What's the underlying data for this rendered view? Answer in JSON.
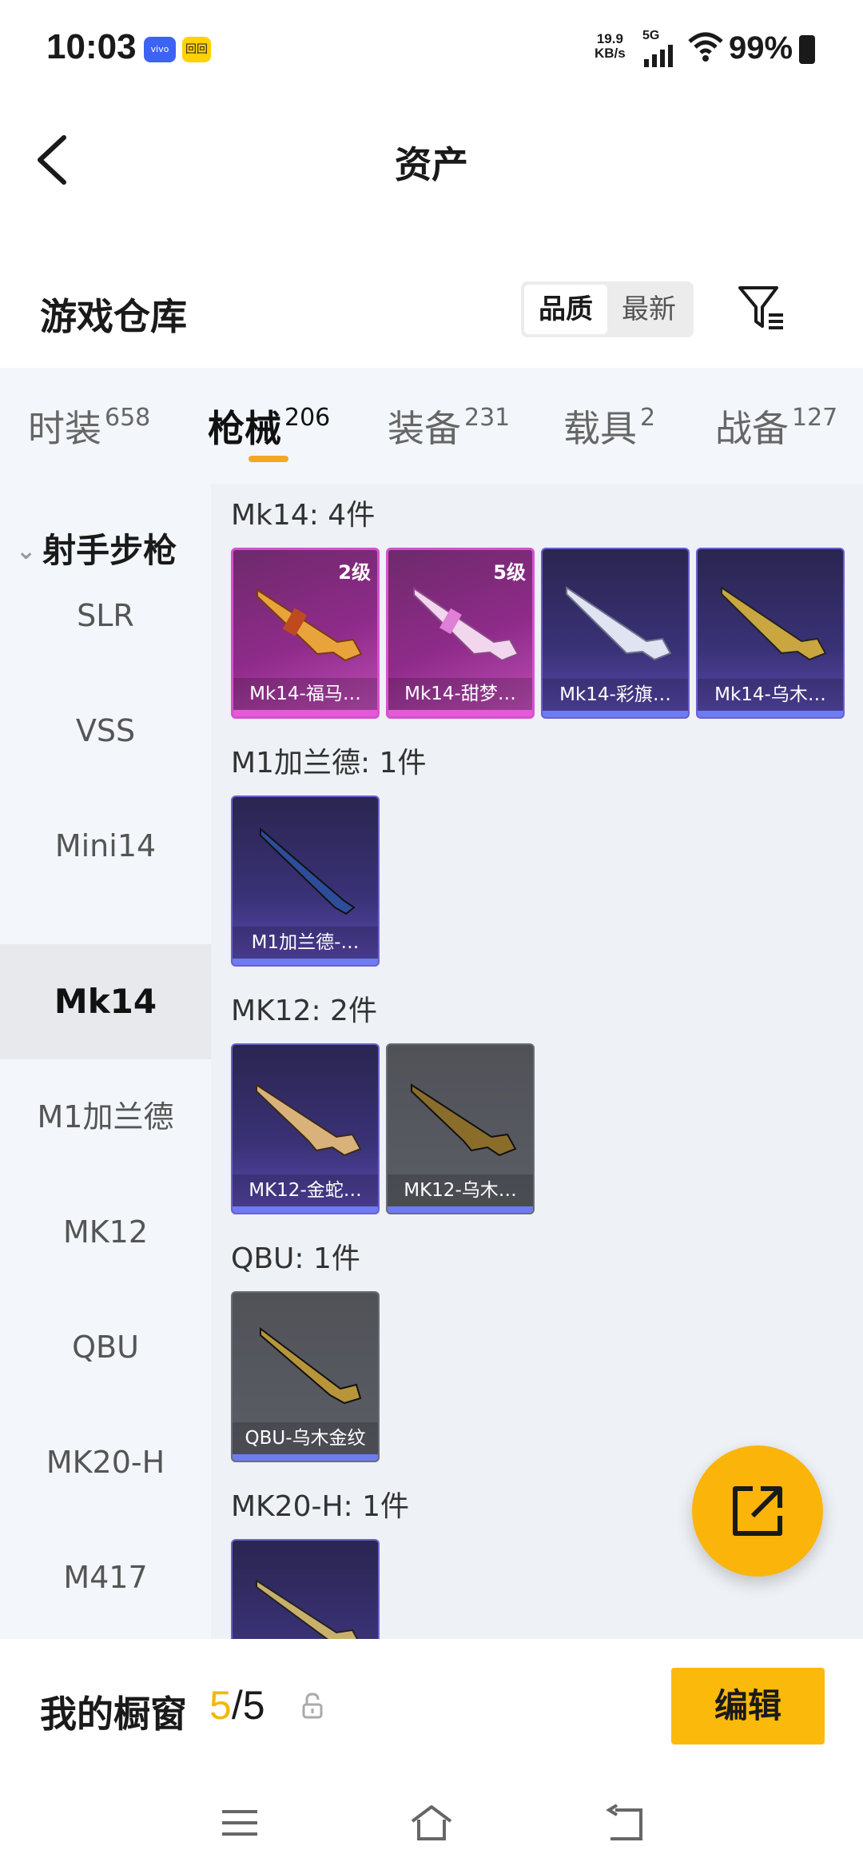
{
  "status_bar": {
    "time": "10:03",
    "app_badge_1": "vivo",
    "app_badge_2": "回回",
    "net_speed_value": "19.9",
    "net_speed_unit": "KB/s",
    "network": "5G",
    "battery": "99%"
  },
  "header": {
    "title": "资产"
  },
  "warehouse": {
    "label": "游戏仓库",
    "sort_options": [
      "品质",
      "最新"
    ],
    "active_sort": "品质"
  },
  "tabs": [
    {
      "label": "时装",
      "count": "658"
    },
    {
      "label": "枪械",
      "count": "206"
    },
    {
      "label": "装备",
      "count": "231"
    },
    {
      "label": "载具",
      "count": "2"
    },
    {
      "label": "战备",
      "count": "127"
    }
  ],
  "sidebar": {
    "group": "射手步枪",
    "items": [
      "SLR",
      "VSS",
      "Mini14",
      "Mk14",
      "M1加兰德",
      "MK12",
      "QBU",
      "MK20-H",
      "M417"
    ],
    "active": "Mk14"
  },
  "sections": [
    {
      "title": "Mk14: 4件",
      "items": [
        {
          "name": "Mk14-福马…",
          "level": "2级",
          "rarity": "pink"
        },
        {
          "name": "Mk14-甜梦…",
          "level": "5级",
          "rarity": "pink"
        },
        {
          "name": "Mk14-彩旗…",
          "level": "",
          "rarity": "purple"
        },
        {
          "name": "Mk14-乌木…",
          "level": "",
          "rarity": "purple"
        }
      ]
    },
    {
      "title": "M1加兰德: 1件",
      "items": [
        {
          "name": "M1加兰德-…",
          "level": "",
          "rarity": "purple"
        }
      ]
    },
    {
      "title": "MK12: 2件",
      "items": [
        {
          "name": "MK12-金蛇…",
          "level": "",
          "rarity": "purple"
        },
        {
          "name": "MK12-乌木…",
          "level": "",
          "rarity": "gray"
        }
      ]
    },
    {
      "title": "QBU: 1件",
      "items": [
        {
          "name": "QBU-乌木金纹",
          "level": "",
          "rarity": "gray"
        }
      ]
    },
    {
      "title": "MK20-H: 1件",
      "items": [
        {
          "name": "",
          "level": "",
          "rarity": "purple"
        }
      ]
    }
  ],
  "showcase": {
    "label": "我的橱窗",
    "current": "5",
    "separator": "/",
    "total": "5",
    "edit_label": "编辑"
  },
  "colors": {
    "accent": "#fbb90b",
    "tab_underline": "#f5a623",
    "rarity_pink": "#d552d0",
    "rarity_purple": "#6d5fcf",
    "rarity_gray": "#5c5e66"
  },
  "icons": {
    "back": "back-arrow-icon",
    "filter": "filter-icon",
    "share": "share-external-icon",
    "lock": "lock-icon",
    "menu": "menu-icon",
    "home": "home-icon",
    "return": "return-icon"
  }
}
